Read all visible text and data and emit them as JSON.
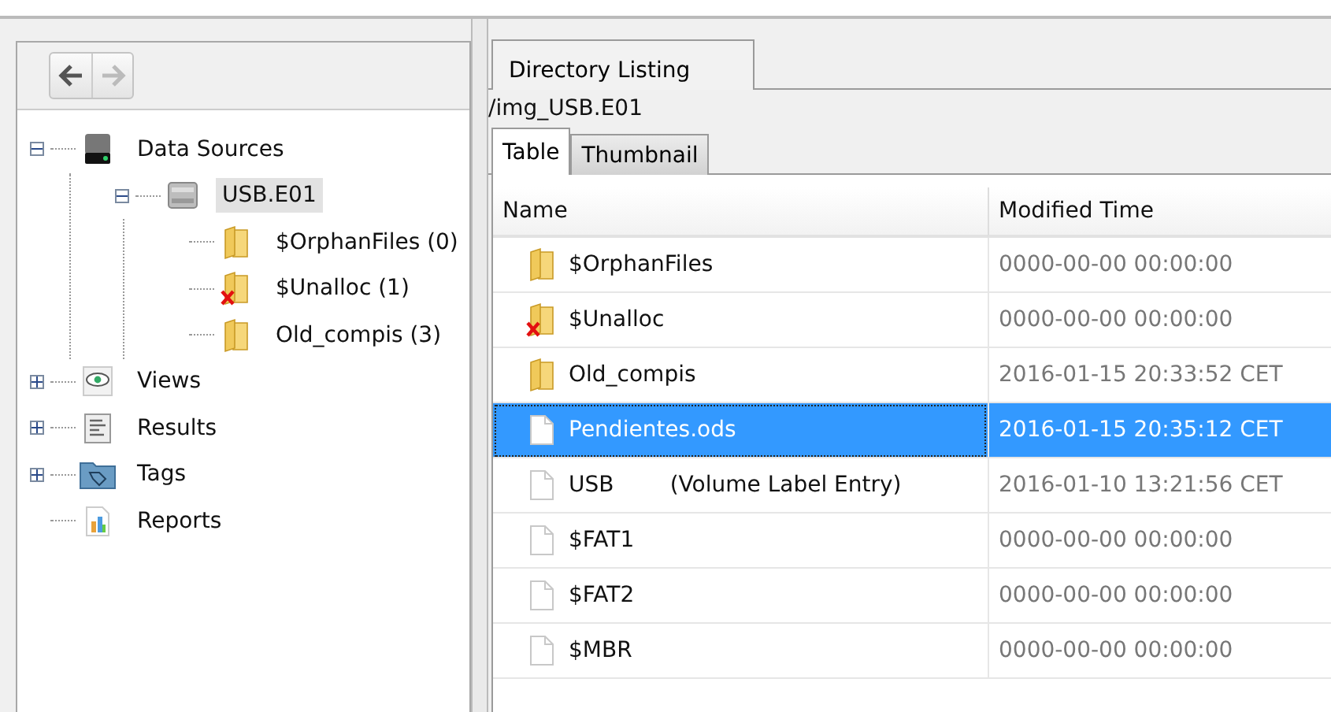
{
  "navigation": {
    "back": {
      "disabled": false
    },
    "forward": {
      "disabled": true
    }
  },
  "tree": [
    {
      "label": "Data Sources",
      "kind": "disk",
      "expanded": true,
      "selected": false,
      "deleted": false,
      "children": [
        {
          "label": "USB.E01",
          "kind": "drive",
          "expanded": true,
          "selected": true,
          "deleted": false,
          "children": [
            {
              "label": "$OrphanFiles (0)",
              "kind": "folder",
              "selected": false,
              "deleted": false
            },
            {
              "label": "$Unalloc (1)",
              "kind": "folder",
              "selected": false,
              "deleted": true
            },
            {
              "label": "Old_compis (3)",
              "kind": "folder",
              "selected": false,
              "deleted": false
            }
          ]
        }
      ]
    },
    {
      "label": "Views",
      "kind": "views",
      "expanded": false,
      "selected": false,
      "deleted": false
    },
    {
      "label": "Results",
      "kind": "results",
      "expanded": false,
      "selected": false,
      "deleted": false
    },
    {
      "label": "Tags",
      "kind": "tags",
      "expanded": false,
      "selected": false,
      "deleted": false
    },
    {
      "label": "Reports",
      "kind": "reports",
      "selected": false,
      "deleted": false
    }
  ],
  "main_tabs": [
    {
      "label": "Directory Listing",
      "selected": true
    }
  ],
  "path": "/img_USB.E01",
  "view_tabs": [
    {
      "label": "Table",
      "selected": true
    },
    {
      "label": "Thumbnail",
      "selected": false
    }
  ],
  "table": {
    "columns": [
      "Name",
      "Modified Time"
    ],
    "rows": [
      {
        "kind": "folder",
        "name": "$OrphanFiles",
        "modified": "0000-00-00 00:00:00",
        "deleted": false,
        "selected": false
      },
      {
        "kind": "folder",
        "name": "$Unalloc",
        "modified": "0000-00-00 00:00:00",
        "deleted": true,
        "selected": false
      },
      {
        "kind": "folder",
        "name": "Old_compis",
        "modified": "2016-01-15 20:33:52 CET",
        "deleted": false,
        "selected": false
      },
      {
        "kind": "file",
        "name": "Pendientes.ods",
        "modified": "2016-01-15 20:35:12 CET",
        "deleted": false,
        "selected": true
      },
      {
        "kind": "file",
        "name": "USB        (Volume Label Entry)",
        "modified": "2016-01-10 13:21:56 CET",
        "deleted": false,
        "selected": false
      },
      {
        "kind": "file",
        "name": "$FAT1",
        "modified": "0000-00-00 00:00:00",
        "deleted": false,
        "selected": false
      },
      {
        "kind": "file",
        "name": "$FAT2",
        "modified": "0000-00-00 00:00:00",
        "deleted": false,
        "selected": false
      },
      {
        "kind": "file",
        "name": "$MBR",
        "modified": "0000-00-00 00:00:00",
        "deleted": false,
        "selected": false
      }
    ]
  }
}
